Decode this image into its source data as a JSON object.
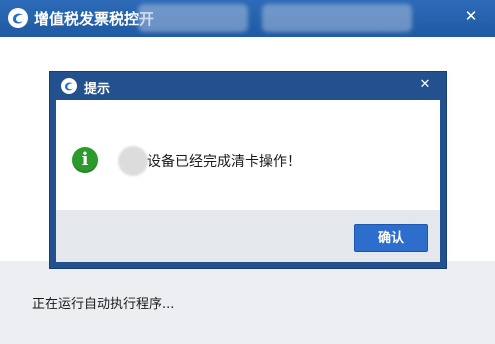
{
  "app": {
    "title": "增值税发票税控开",
    "close_glyph": "✕",
    "logo_icon": "tax-control-logo-icon",
    "status_text": "正在运行自动执行程序..."
  },
  "dialog": {
    "title": "提示",
    "close_glyph": "✕",
    "logo_icon": "tax-control-logo-icon",
    "info_icon": "info-icon",
    "info_glyph": "i",
    "message": "设备已经完成清卡操作！",
    "ok_label": "确认"
  },
  "colors": {
    "title_bar": "#1f5aa3",
    "dialog_frame": "#23508f",
    "info_green": "#2d9a2d",
    "button_blue": "#2d6dcc"
  }
}
